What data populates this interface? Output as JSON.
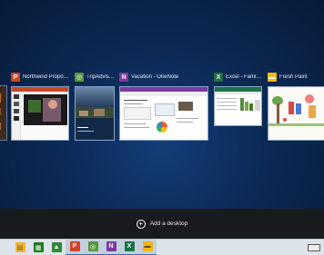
{
  "windows": [
    {
      "title": "",
      "icon": "windows-icon",
      "color": "#5b4a3a"
    },
    {
      "title": "Northwind Proposa...",
      "icon": "powerpoint-icon",
      "color": "#d04526"
    },
    {
      "title": "TripAdvisor...",
      "icon": "tripadvisor-icon",
      "color": "#589442"
    },
    {
      "title": "Vacation - OneNote",
      "icon": "onenote-icon",
      "color": "#7c3a9a"
    },
    {
      "title": "Excel - Family...",
      "icon": "excel-icon",
      "color": "#1e7145"
    },
    {
      "title": "Fresh Paint",
      "icon": "fresh-paint-icon",
      "color": "#f3b51a"
    }
  ],
  "add_desktop": {
    "label": "Add a desktop",
    "icon": "plus-circle-icon"
  },
  "taskbar": {
    "items": [
      {
        "name": "explorer-icon",
        "color": "#f0b43a",
        "glyph": "▤"
      },
      {
        "name": "store-icon",
        "color": "#1e7a1e",
        "glyph": "▦"
      },
      {
        "name": "finance-icon",
        "color": "#2f8a3a",
        "glyph": "▲"
      },
      {
        "name": "powerpoint-icon",
        "color": "#d04526",
        "glyph": "P"
      },
      {
        "name": "tripadvisor-icon",
        "color": "#589442",
        "glyph": "◎"
      },
      {
        "name": "onenote-icon",
        "color": "#7c3a9a",
        "glyph": "N"
      },
      {
        "name": "excel-icon",
        "color": "#1e7145",
        "glyph": "X"
      },
      {
        "name": "fresh-paint-icon",
        "color": "#f3b51a",
        "glyph": "▬"
      }
    ]
  }
}
